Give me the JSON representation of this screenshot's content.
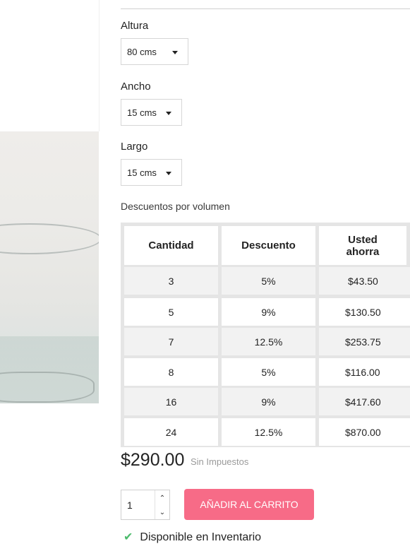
{
  "options": [
    {
      "label": "Altura",
      "value": "80 cms"
    },
    {
      "label": "Ancho",
      "value": "15 cms"
    },
    {
      "label": "Largo",
      "value": "15 cms"
    }
  ],
  "discounts": {
    "title": "Descuentos por volumen",
    "headers": [
      "Cantidad",
      "Descuento",
      "Usted ahorra"
    ],
    "rows": [
      [
        "3",
        "5%",
        "$43.50"
      ],
      [
        "5",
        "9%",
        "$130.50"
      ],
      [
        "7",
        "12.5%",
        "$253.75"
      ],
      [
        "8",
        "5%",
        "$116.00"
      ],
      [
        "16",
        "9%",
        "$417.60"
      ],
      [
        "24",
        "12.5%",
        "$870.00"
      ]
    ]
  },
  "price": {
    "amount": "$290.00",
    "tax_label": "Sin Impuestos"
  },
  "cart": {
    "quantity": "1",
    "add_label": "AÑADIR AL CARRITO",
    "availability": "Disponible en Inventario",
    "up_icon": "chevron-up-icon",
    "down_icon": "chevron-down-icon"
  },
  "colors": {
    "accent": "#f76b87",
    "check": "#4cbb6c"
  }
}
